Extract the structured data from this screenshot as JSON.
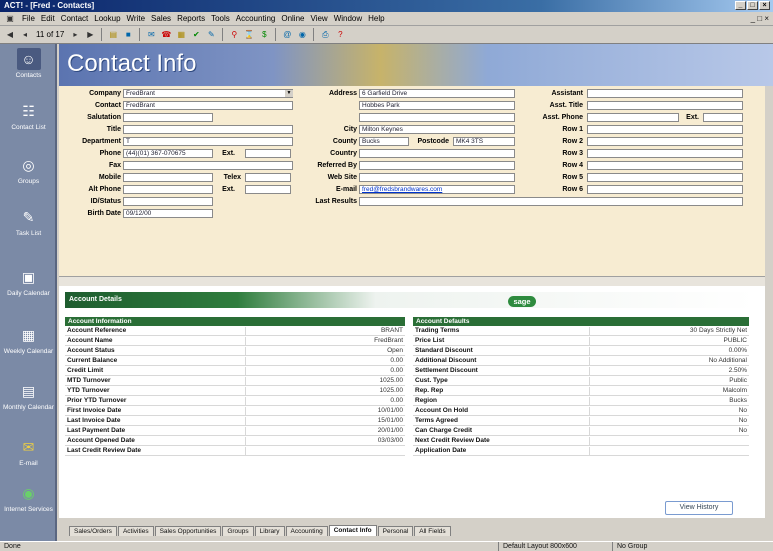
{
  "window": {
    "title": "ACT! - [Fred - Contacts]"
  },
  "menu": [
    "File",
    "Edit",
    "Contact",
    "Lookup",
    "Write",
    "Sales",
    "Reports",
    "Tools",
    "Accounting",
    "Online",
    "View",
    "Window",
    "Help"
  ],
  "toolbar": {
    "record_counter": "11 of 17"
  },
  "sidebar": [
    {
      "label": "Contacts",
      "icon": "person-icon"
    },
    {
      "label": "Contact List",
      "icon": "contact-list-icon"
    },
    {
      "label": "Groups",
      "icon": "groups-icon"
    },
    {
      "label": "Task List",
      "icon": "task-list-icon"
    },
    {
      "label": "Daily Calendar",
      "icon": "daily-calendar-icon"
    },
    {
      "label": "Weekly Calendar",
      "icon": "weekly-calendar-icon"
    },
    {
      "label": "Monthly Calendar",
      "icon": "monthly-calendar-icon"
    },
    {
      "label": "E-mail",
      "icon": "email-icon"
    },
    {
      "label": "Internet Services",
      "icon": "internet-icon"
    }
  ],
  "page_title": "Contact Info",
  "form": {
    "col1": [
      {
        "label": "Company",
        "value": "FredBrant"
      },
      {
        "label": "Contact",
        "value": "FredBrant"
      },
      {
        "label": "Salutation",
        "value": ""
      },
      {
        "label": "Title",
        "value": ""
      },
      {
        "label": "Department",
        "value": "T"
      },
      {
        "label": "Phone",
        "value": "(44)(01) 367-070675"
      },
      {
        "label": "Fax",
        "value": ""
      },
      {
        "label": "Mobile",
        "value": ""
      },
      {
        "label": "Alt Phone",
        "value": ""
      },
      {
        "label": "ID/Status",
        "value": ""
      },
      {
        "label": "Birth Date",
        "value": "09/12/00"
      }
    ],
    "ext_label": "Ext.",
    "telex_label": "Telex",
    "col2": [
      {
        "label": "Address",
        "value": "6 Garfield Drive"
      },
      {
        "label": "",
        "value": "Hobbes Park"
      },
      {
        "label": "",
        "value": ""
      },
      {
        "label": "City",
        "value": "Milton Keynes"
      },
      {
        "label": "County",
        "value": "Bucks"
      },
      {
        "label": "Country",
        "value": ""
      },
      {
        "label": "Referred By",
        "value": ""
      },
      {
        "label": "Web Site",
        "value": ""
      },
      {
        "label": "E-mail",
        "value": "fred@fredsbrandwares.com"
      },
      {
        "label": "Last Results",
        "value": ""
      }
    ],
    "postcode_label": "Postcode",
    "postcode_value": "MK4 3TS",
    "col3": [
      {
        "label": "Assistant",
        "value": ""
      },
      {
        "label": "Asst. Title",
        "value": ""
      },
      {
        "label": "Asst. Phone",
        "value": ""
      },
      {
        "label": "Row 1",
        "value": ""
      },
      {
        "label": "Row 2",
        "value": ""
      },
      {
        "label": "Row 3",
        "value": ""
      },
      {
        "label": "Row 4",
        "value": ""
      },
      {
        "label": "Row 5",
        "value": ""
      },
      {
        "label": "Row 6",
        "value": ""
      }
    ],
    "asst_ext_label": "Ext."
  },
  "panel": {
    "title": "Account Details",
    "logo": "sage",
    "info_title": "Account Information",
    "info": [
      [
        "Account Reference",
        "BRANT"
      ],
      [
        "Account Name",
        "FredBrant"
      ],
      [
        "Account Status",
        "Open"
      ],
      [
        "Current Balance",
        "0.00"
      ],
      [
        "Credit Limit",
        "0.00"
      ],
      [
        "MTD Turnover",
        "1025.00"
      ],
      [
        "YTD Turnover",
        "1025.00"
      ],
      [
        "Prior YTD Turnover",
        "0.00"
      ],
      [
        "First Invoice Date",
        "10/01/00"
      ],
      [
        "Last Invoice Date",
        "15/01/00"
      ],
      [
        "Last Payment Date",
        "20/01/00"
      ],
      [
        "Account Opened Date",
        "03/03/00"
      ],
      [
        "Last Credit Review Date",
        ""
      ]
    ],
    "defaults_title": "Account Defaults",
    "defaults": [
      [
        "Trading Terms",
        "30 Days Strictly Net"
      ],
      [
        "Price List",
        "PUBLIC"
      ],
      [
        "Standard Discount",
        "0.00%"
      ],
      [
        "Additional Discount",
        "No Additional"
      ],
      [
        "Settlement Discount",
        "2.50%"
      ],
      [
        "Cust. Type",
        "Public"
      ],
      [
        "Rep. Rep",
        "Malcolm"
      ],
      [
        "Region",
        "Bucks"
      ],
      [
        "Account On Hold",
        "No"
      ],
      [
        "Terms Agreed",
        "No"
      ],
      [
        "Can Charge Credit",
        "No"
      ],
      [
        "Next Credit Review Date",
        ""
      ],
      [
        "Application Date",
        ""
      ]
    ],
    "view_history": "View History"
  },
  "tabs": [
    "Sales/Orders",
    "Activities",
    "Sales Opportunities",
    "Groups",
    "Library",
    "Accounting",
    "Contact Info",
    "Personal",
    "All Fields"
  ],
  "active_tab": "Contact Info",
  "status": {
    "left": "Done",
    "layout": "Default Layout 800x600",
    "group": "No Group"
  }
}
